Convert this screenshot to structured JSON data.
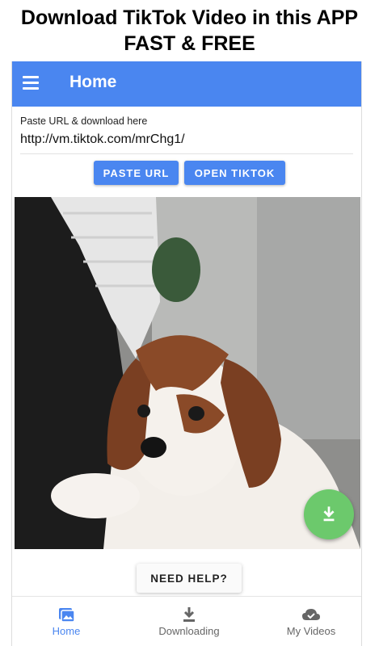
{
  "promo": {
    "line1": "Download TikTok Video in this APP",
    "line2": "FAST & FREE"
  },
  "appbar": {
    "title": "Home",
    "menu_icon": "hamburger-menu-icon"
  },
  "url_section": {
    "label": "Paste URL & download here",
    "value": "http://vm.tiktok.com/mrChg1/"
  },
  "buttons": {
    "paste": "PASTE URL",
    "open": "OPEN TIKTOK"
  },
  "preview": {
    "description_icon": "video-thumbnail",
    "fab_icon": "download-icon"
  },
  "help": {
    "label": "NEED HELP?"
  },
  "nav": {
    "home": "Home",
    "downloading": "Downloading",
    "my_videos": "My Videos"
  },
  "colors": {
    "primary": "#4a86f0",
    "fab": "#6cc96c"
  }
}
